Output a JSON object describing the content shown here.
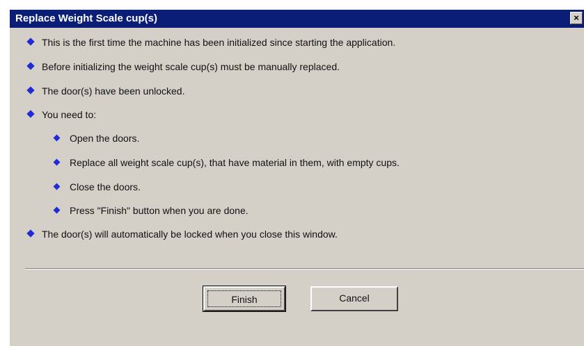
{
  "window": {
    "title": "Replace Weight Scale cup(s)",
    "close_glyph": "×"
  },
  "bullets": [
    {
      "text": "This is the first time the machine has been initialized since starting the application."
    },
    {
      "text": "Before initializing the weight scale cup(s) must be manually replaced."
    },
    {
      "text": "The door(s) have been unlocked."
    },
    {
      "text": "You need to:"
    },
    {
      "text": "Open the doors."
    },
    {
      "text": "Replace all weight scale cup(s), that have material in them, with empty cups."
    },
    {
      "text": "Close the doors."
    },
    {
      "text": "Press \"Finish\" button when you are done."
    },
    {
      "text": "The door(s) will automatically be locked when you close this window."
    }
  ],
  "buttons": {
    "finish": "Finish",
    "cancel": "Cancel"
  },
  "colors": {
    "titlebar": "#0a1e78",
    "bullet": "#1f2bd6",
    "dialog_bg": "#d4d0c8"
  },
  "icons": {
    "bullet": "diamond-bullet-icon",
    "close": "close-icon"
  }
}
